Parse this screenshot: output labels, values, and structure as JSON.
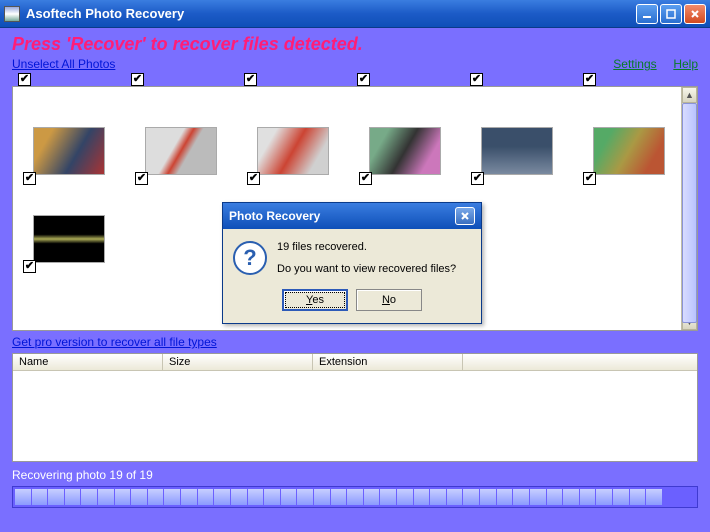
{
  "title": "Asoftech Photo Recovery",
  "prompt": "Press 'Recover' to recover files detected.",
  "links": {
    "unselect": "Unselect All Photos",
    "settings": "Settings",
    "help": "Help",
    "pro": "Get pro version to recover all file types"
  },
  "table": {
    "headers": [
      "Name",
      "Size",
      "Extension"
    ]
  },
  "status": "Recovering photo 19 of 19",
  "progress": {
    "segments": 41,
    "filled": 39
  },
  "dialog": {
    "title": "Photo Recovery",
    "line1": "19 files recovered.",
    "line2": "Do you want to view recovered files?",
    "yes": "Yes",
    "no": "No"
  },
  "thumbs": [
    {
      "id": "img-a",
      "checked": true
    },
    {
      "id": "img-b",
      "checked": true
    },
    {
      "id": "img-c",
      "checked": true
    },
    {
      "id": "img-d",
      "checked": true
    },
    {
      "id": "img-e",
      "checked": true
    },
    {
      "id": "img-f",
      "checked": true
    },
    {
      "id": "img-g",
      "checked": true
    }
  ]
}
